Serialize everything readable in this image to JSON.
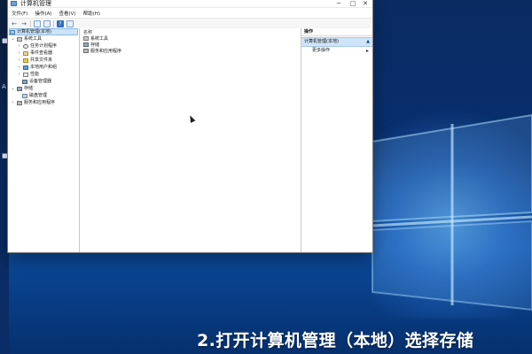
{
  "window": {
    "title": "计算机管理",
    "controls": {
      "minimize": "─",
      "maximize": "□",
      "close": "✕"
    }
  },
  "menubar": {
    "items": [
      "文件(F)",
      "操作(A)",
      "查看(V)",
      "帮助(H)"
    ]
  },
  "toolbar": {
    "icons": [
      "back-arrow-icon",
      "forward-arrow-icon",
      "show-tree-icon",
      "export-icon",
      "help-icon",
      "properties-icon"
    ]
  },
  "tree": {
    "root": "计算机管理(本地)",
    "system_tools": "系统工具",
    "task_scheduler": "任务计划程序",
    "event_viewer": "事件查看器",
    "shared_folders": "共享文件夹",
    "local_users": "本地用户和组",
    "performance": "性能",
    "device_manager": "设备管理器",
    "storage": "存储",
    "disk_management": "磁盘管理",
    "services_apps": "服务和应用程序"
  },
  "middle": {
    "column_header": "名称",
    "items": [
      "系统工具",
      "存储",
      "服务和应用程序"
    ]
  },
  "actions": {
    "header": "操作",
    "section": "计算机管理(本地)",
    "more": "更多操作"
  },
  "caption": "2.打开计算机管理（本地）选择存储"
}
